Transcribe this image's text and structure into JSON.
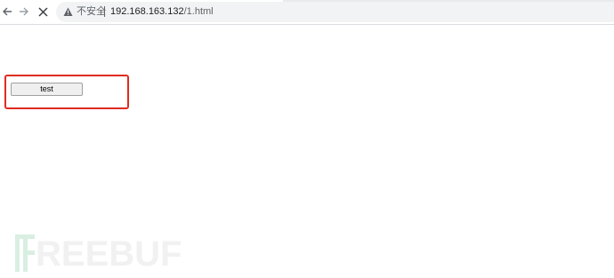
{
  "browser": {
    "security_label": "不安全",
    "url_host": "192.168.163.132",
    "url_path": "/1.html",
    "icons": {
      "back": "arrow-left-icon",
      "forward": "arrow-right-icon",
      "stop": "close-icon",
      "security": "warning-triangle-icon"
    }
  },
  "page": {
    "button_label": "test",
    "highlight_color": "#e02b20"
  },
  "watermark": {
    "text": "REEBUF"
  }
}
